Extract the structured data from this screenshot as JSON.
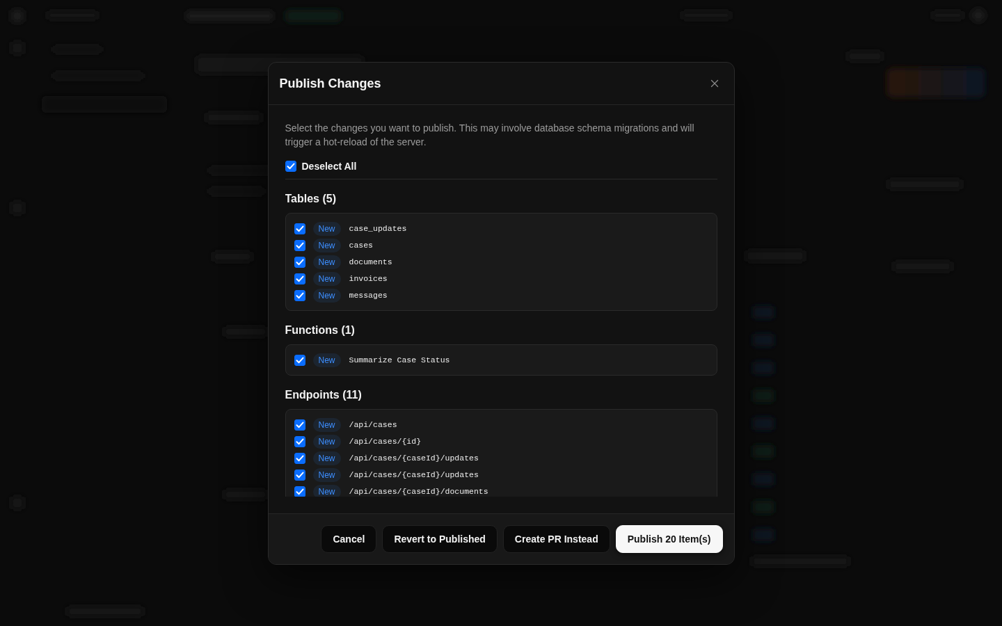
{
  "dialog": {
    "title": "Publish Changes",
    "description": "Select the changes you want to publish. This may involve database schema migrations and will trigger a hot-reload of the server.",
    "select_all": {
      "label": "Deselect All",
      "checked": true
    },
    "sections": [
      {
        "title": "Tables (5)",
        "items": [
          {
            "checked": true,
            "badge": "New",
            "name": "case_updates"
          },
          {
            "checked": true,
            "badge": "New",
            "name": "cases"
          },
          {
            "checked": true,
            "badge": "New",
            "name": "documents"
          },
          {
            "checked": true,
            "badge": "New",
            "name": "invoices"
          },
          {
            "checked": true,
            "badge": "New",
            "name": "messages"
          }
        ]
      },
      {
        "title": "Functions (1)",
        "items": [
          {
            "checked": true,
            "badge": "New",
            "name": "Summarize Case Status"
          }
        ]
      },
      {
        "title": "Endpoints (11)",
        "items": [
          {
            "checked": true,
            "badge": "New",
            "name": "/api/cases"
          },
          {
            "checked": true,
            "badge": "New",
            "name": "/api/cases/{id}"
          },
          {
            "checked": true,
            "badge": "New",
            "name": "/api/cases/{caseId}/updates"
          },
          {
            "checked": true,
            "badge": "New",
            "name": "/api/cases/{caseId}/updates"
          },
          {
            "checked": true,
            "badge": "New",
            "name": "/api/cases/{caseId}/documents"
          }
        ]
      }
    ],
    "buttons": [
      {
        "label": "Cancel",
        "kind": "secondary"
      },
      {
        "label": "Revert to Published",
        "kind": "secondary"
      },
      {
        "label": "Create PR Instead",
        "kind": "secondary"
      },
      {
        "label": "Publish 20 Item(s)",
        "kind": "primary"
      }
    ]
  }
}
